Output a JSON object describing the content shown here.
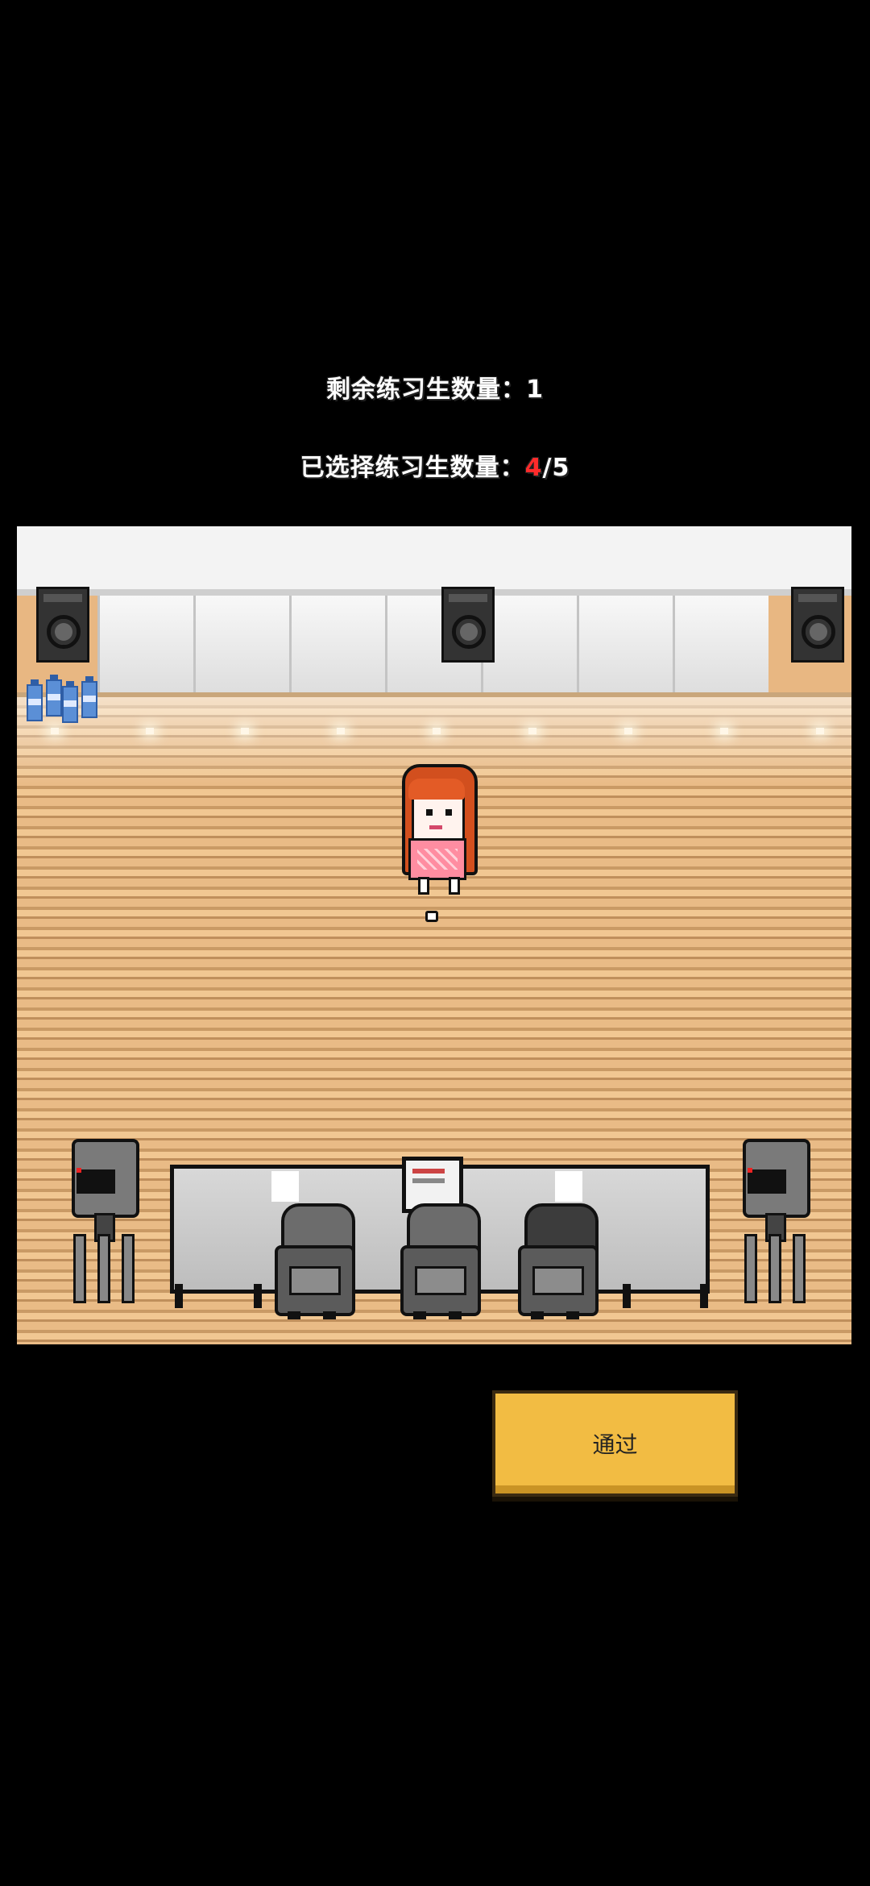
{
  "hud": {
    "remaining_label": "剩余练习生数量：",
    "remaining_value": "1",
    "selected_label": "已选择练习生数量：",
    "selected_current": "4",
    "selected_total": "/5"
  },
  "buttons": {
    "pass_label": "通过"
  },
  "colors": {
    "highlight": "#ff2b2b",
    "button_fill": "#f2bc43",
    "floor": "#e9bb86"
  }
}
